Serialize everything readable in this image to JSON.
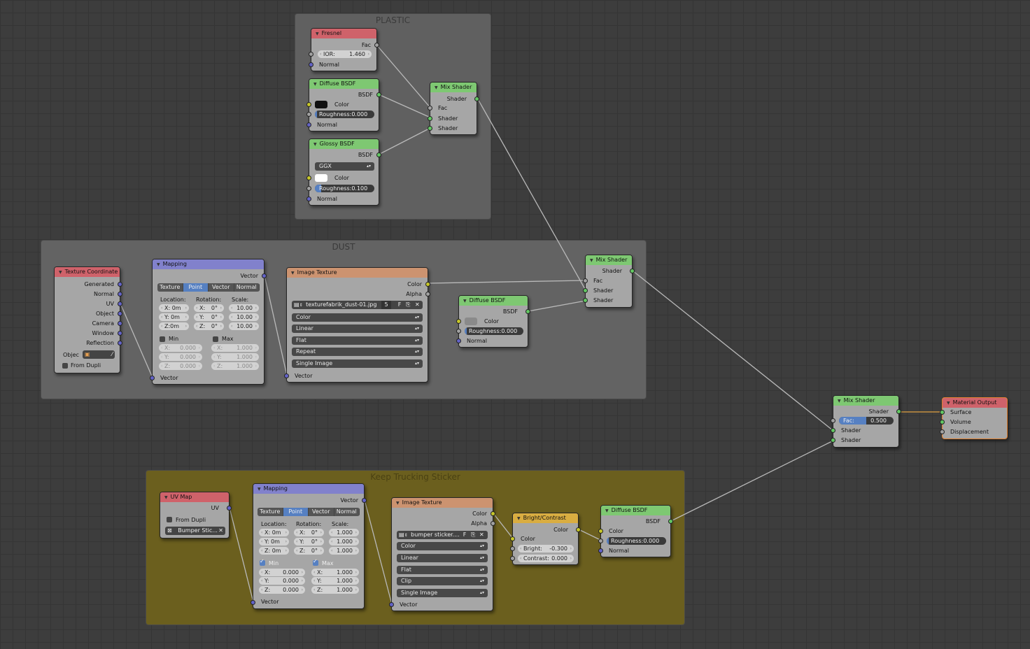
{
  "frames": {
    "plastic": "PLASTIC",
    "dust": "DUST",
    "sticker": "Keep Trucking Sticker"
  },
  "common": {
    "color": "Color",
    "normal": "Normal",
    "fac": "Fac",
    "shader": "Shader",
    "bsdf": "BSDF",
    "vector": "Vector",
    "alpha": "Alpha",
    "min": "Min",
    "max": "Max",
    "location": "Location:",
    "rotation": "Rotation:",
    "scale": "Scale:"
  },
  "fresnel": {
    "title": "Fresnel",
    "ior_label": "IOR:",
    "ior_value": "1.460"
  },
  "diffuse1": {
    "title": "Diffuse BSDF",
    "roughness": "Roughness:0.000"
  },
  "glossy": {
    "title": "Glossy BSDF",
    "distribution": "GGX",
    "roughness": "Roughness:0.100"
  },
  "mix1": {
    "title": "Mix Shader"
  },
  "texcoord": {
    "title": "Texture Coordinate",
    "outputs": [
      "Generated",
      "Normal",
      "UV",
      "Object",
      "Camera",
      "Window",
      "Reflection"
    ],
    "object_label": "Objec",
    "from_dupli": "From Dupli"
  },
  "mapping1": {
    "title": "Mapping",
    "tabs": [
      "Texture",
      "Point",
      "Vector",
      "Normal"
    ],
    "loc": [
      "X: 0m",
      "Y: 0m",
      "Z:0m"
    ],
    "rot": [
      "X:",
      "Y:",
      "Z:"
    ],
    "rot_v": [
      "0°",
      "0°",
      "0°"
    ],
    "scale": [
      "10.00",
      "10.00",
      "10.00"
    ],
    "min": [
      "0.000",
      "0.000",
      "0.000"
    ],
    "max": [
      "1.000",
      "1.000",
      "1.000"
    ]
  },
  "imgtex1": {
    "title": "Image Texture",
    "file": "texturefabrik_dust-01.jpg",
    "users": "5",
    "fake": "F",
    "options": [
      "Color",
      "Linear",
      "Flat",
      "Repeat",
      "Single Image"
    ]
  },
  "diffuse2": {
    "title": "Diffuse BSDF",
    "roughness": "Roughness:0.000"
  },
  "mix2": {
    "title": "Mix Shader"
  },
  "mix3": {
    "title": "Mix Shader",
    "fac_label": "Fac:",
    "fac_value": "0.500",
    "fac": 0.5
  },
  "output": {
    "title": "Material Output",
    "inputs": [
      "Surface",
      "Volume",
      "Displacement"
    ]
  },
  "uvmap": {
    "title": "UV Map",
    "uv": "UV",
    "from_dupli": "From Dupli",
    "map": "Bumper Stic..."
  },
  "mapping2": {
    "title": "Mapping",
    "tabs": [
      "Texture",
      "Point",
      "Vector",
      "Normal"
    ],
    "loc": [
      "X: 0m",
      "Y: 0m",
      "Z: 0m"
    ],
    "rot": [
      "X:",
      "Y:",
      "Z:"
    ],
    "rot_v": [
      "0°",
      "0°",
      "0°"
    ],
    "scale": [
      "1.000",
      "1.000",
      "1.000"
    ],
    "min": [
      "0.000",
      "0.000",
      "0.000"
    ],
    "max": [
      "1.000",
      "1.000",
      "1.000"
    ]
  },
  "imgtex2": {
    "title": "Image Texture",
    "file": "bumper sticker....",
    "fake": "F",
    "options": [
      "Color",
      "Linear",
      "Flat",
      "Clip",
      "Single Image"
    ]
  },
  "bright": {
    "title": "Bright/Contrast",
    "bright": "Bright:",
    "bright_v": "-0.300",
    "contrast": "Contrast:",
    "contrast_v": "0.000"
  },
  "diffuse3": {
    "title": "Diffuse BSDF",
    "roughness": "Roughness:0.000"
  },
  "colors": {
    "frame_plastic": "#606060",
    "frame_dust": "#636363",
    "frame_sticker": "#6b5f1e",
    "link": "#b9b9b9",
    "link_output": "#e0a040",
    "select": "#5680c2"
  }
}
